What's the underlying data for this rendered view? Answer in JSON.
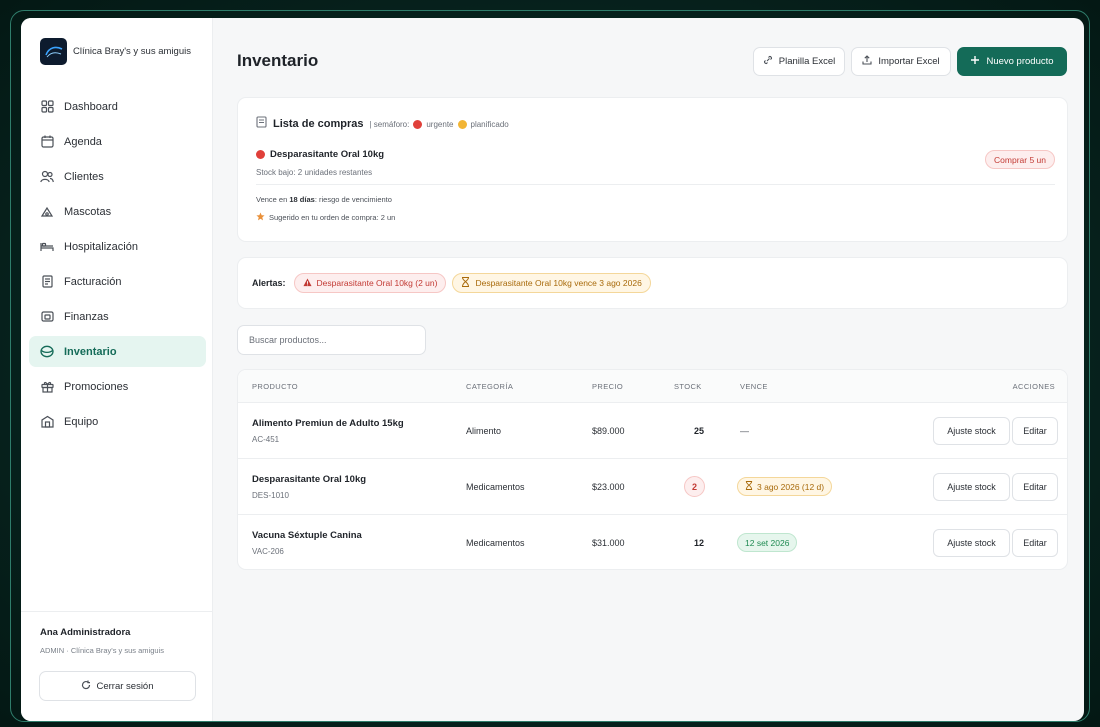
{
  "sidebar": {
    "brand": {
      "name": "Clínica Bray's y sus amiguis"
    },
    "items": [
      {
        "label": "Dashboard",
        "icon": "grid-icon"
      },
      {
        "label": "Agenda",
        "icon": "calendar-icon"
      },
      {
        "label": "Clientes",
        "icon": "users-icon"
      },
      {
        "label": "Mascotas",
        "icon": "paw-icon"
      },
      {
        "label": "Hospitalización",
        "icon": "bed-icon"
      },
      {
        "label": "Facturación",
        "icon": "receipt-icon"
      },
      {
        "label": "Finanzas",
        "icon": "wallet-icon"
      },
      {
        "label": "Inventario",
        "icon": "box-icon",
        "active": true
      },
      {
        "label": "Promociones",
        "icon": "gift-icon"
      },
      {
        "label": "Equipo",
        "icon": "team-icon"
      }
    ],
    "user": {
      "name": "Ana Administradora",
      "role": "ADMIN · Clínica Bray's y sus amiguis",
      "logout_label": "Cerrar sesión"
    }
  },
  "header": {
    "title": "Inventario",
    "buttons": {
      "template": "Planilla Excel",
      "import": "Importar Excel",
      "new_product": "Nuevo producto"
    }
  },
  "shopping_list": {
    "title": "Lista de compras",
    "legend_prefix": "| semáforo:",
    "legend_urgent": "urgente",
    "legend_planned": "planificado",
    "item": {
      "name": "Desparasitante Oral 10kg",
      "detail": "Stock bajo: 2 unidades restantes",
      "expiry_prefix": "Vence en",
      "expiry_days": "18 días",
      "expiry_suffix": ": riesgo de vencimiento",
      "suggestion": "Sugerido en tu orden de compra: 2 un",
      "buy_label": "Comprar 5 un"
    }
  },
  "alerts": {
    "label": "Alertas:",
    "items": [
      {
        "text": "Desparasitante Oral 10kg (2 un)",
        "level": "urgent"
      },
      {
        "text": "Desparasitante Oral 10kg vence 3 ago 2026",
        "level": "warning"
      }
    ]
  },
  "search": {
    "placeholder": "Buscar productos..."
  },
  "table": {
    "headers": {
      "product": "PRODUCTO",
      "category": "CATEGORÍA",
      "price": "PRECIO",
      "stock": "STOCK",
      "expiry": "VENCE",
      "actions": "ACCIONES"
    },
    "rows": [
      {
        "name": "Alimento Premiun de Adulto 15kg",
        "code": "AC-451",
        "category": "Alimento",
        "price": "$89.000",
        "stock": "25",
        "expiry": "—",
        "adjust": "Ajuste stock",
        "edit": "Editar"
      },
      {
        "name": "Desparasitante Oral 10kg",
        "code": "DES-1010",
        "category": "Medicamentos",
        "price": "$23.000",
        "stock": "2",
        "expiry": "3 ago 2026 (12 d)",
        "adjust": "Ajuste stock",
        "edit": "Editar"
      },
      {
        "name": "Vacuna Séxtuple Canina",
        "code": "VAC-206",
        "category": "Medicamentos",
        "price": "$31.000",
        "stock": "12",
        "expiry": "12 set 2026",
        "adjust": "Ajuste stock",
        "edit": "Editar"
      }
    ]
  },
  "colors": {
    "primary": "#146b58",
    "active_bg": "#e5f5f0",
    "urgent": "#e0403a",
    "warning": "#f2b535",
    "ok": "#1f8a52",
    "background_glow": "#0f3b33"
  }
}
